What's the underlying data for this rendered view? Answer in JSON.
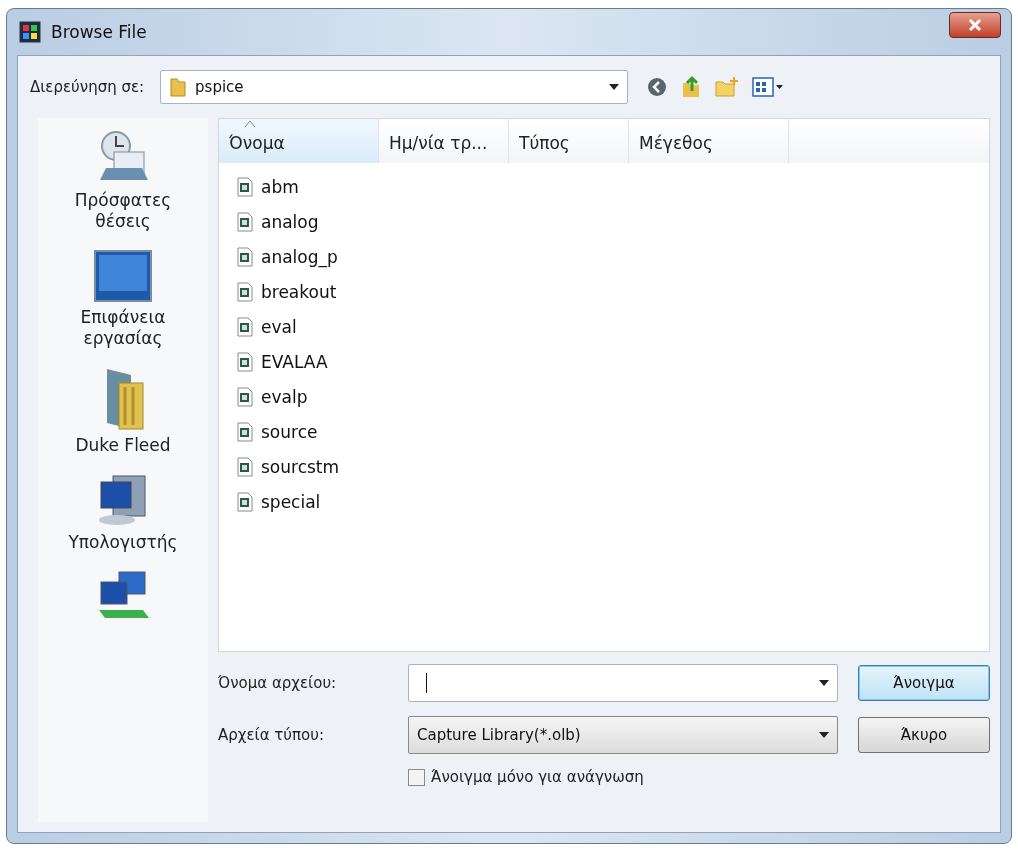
{
  "window": {
    "title": "Browse File"
  },
  "look_in": {
    "label": "Διερεύνηση σε:",
    "value": "pspice"
  },
  "places": [
    {
      "kind": "recent",
      "label": "Πρόσφατες θέσεις"
    },
    {
      "kind": "desktop",
      "label": "Επιφάνεια εργασίας"
    },
    {
      "kind": "user",
      "label": "Duke Fleed"
    },
    {
      "kind": "computer",
      "label": "Υπολογιστής"
    },
    {
      "kind": "network"
    }
  ],
  "columns": [
    {
      "label": "Όνομα",
      "sorted": true
    },
    {
      "label": "Ημ/νία τρ...",
      "sorted": false
    },
    {
      "label": "Τύπος",
      "sorted": false
    },
    {
      "label": "Μέγεθος",
      "sorted": false
    }
  ],
  "files": [
    "abm",
    "analog",
    "analog_p",
    "breakout",
    "eval",
    "EVALAA",
    "evalp",
    "source",
    "sourcstm",
    "special"
  ],
  "file_name": {
    "label": "Όνομα αρχείου:"
  },
  "file_type": {
    "label": "Αρχεία τύπου:",
    "value": "Capture Library(*.olb)"
  },
  "read_only": {
    "label": "Άνοιγμα μόνο για ανάγνωση",
    "checked": false
  },
  "buttons": [
    {
      "label": "Άνοιγμα",
      "default": true
    },
    {
      "label": "Άκυρο",
      "default": false
    }
  ]
}
